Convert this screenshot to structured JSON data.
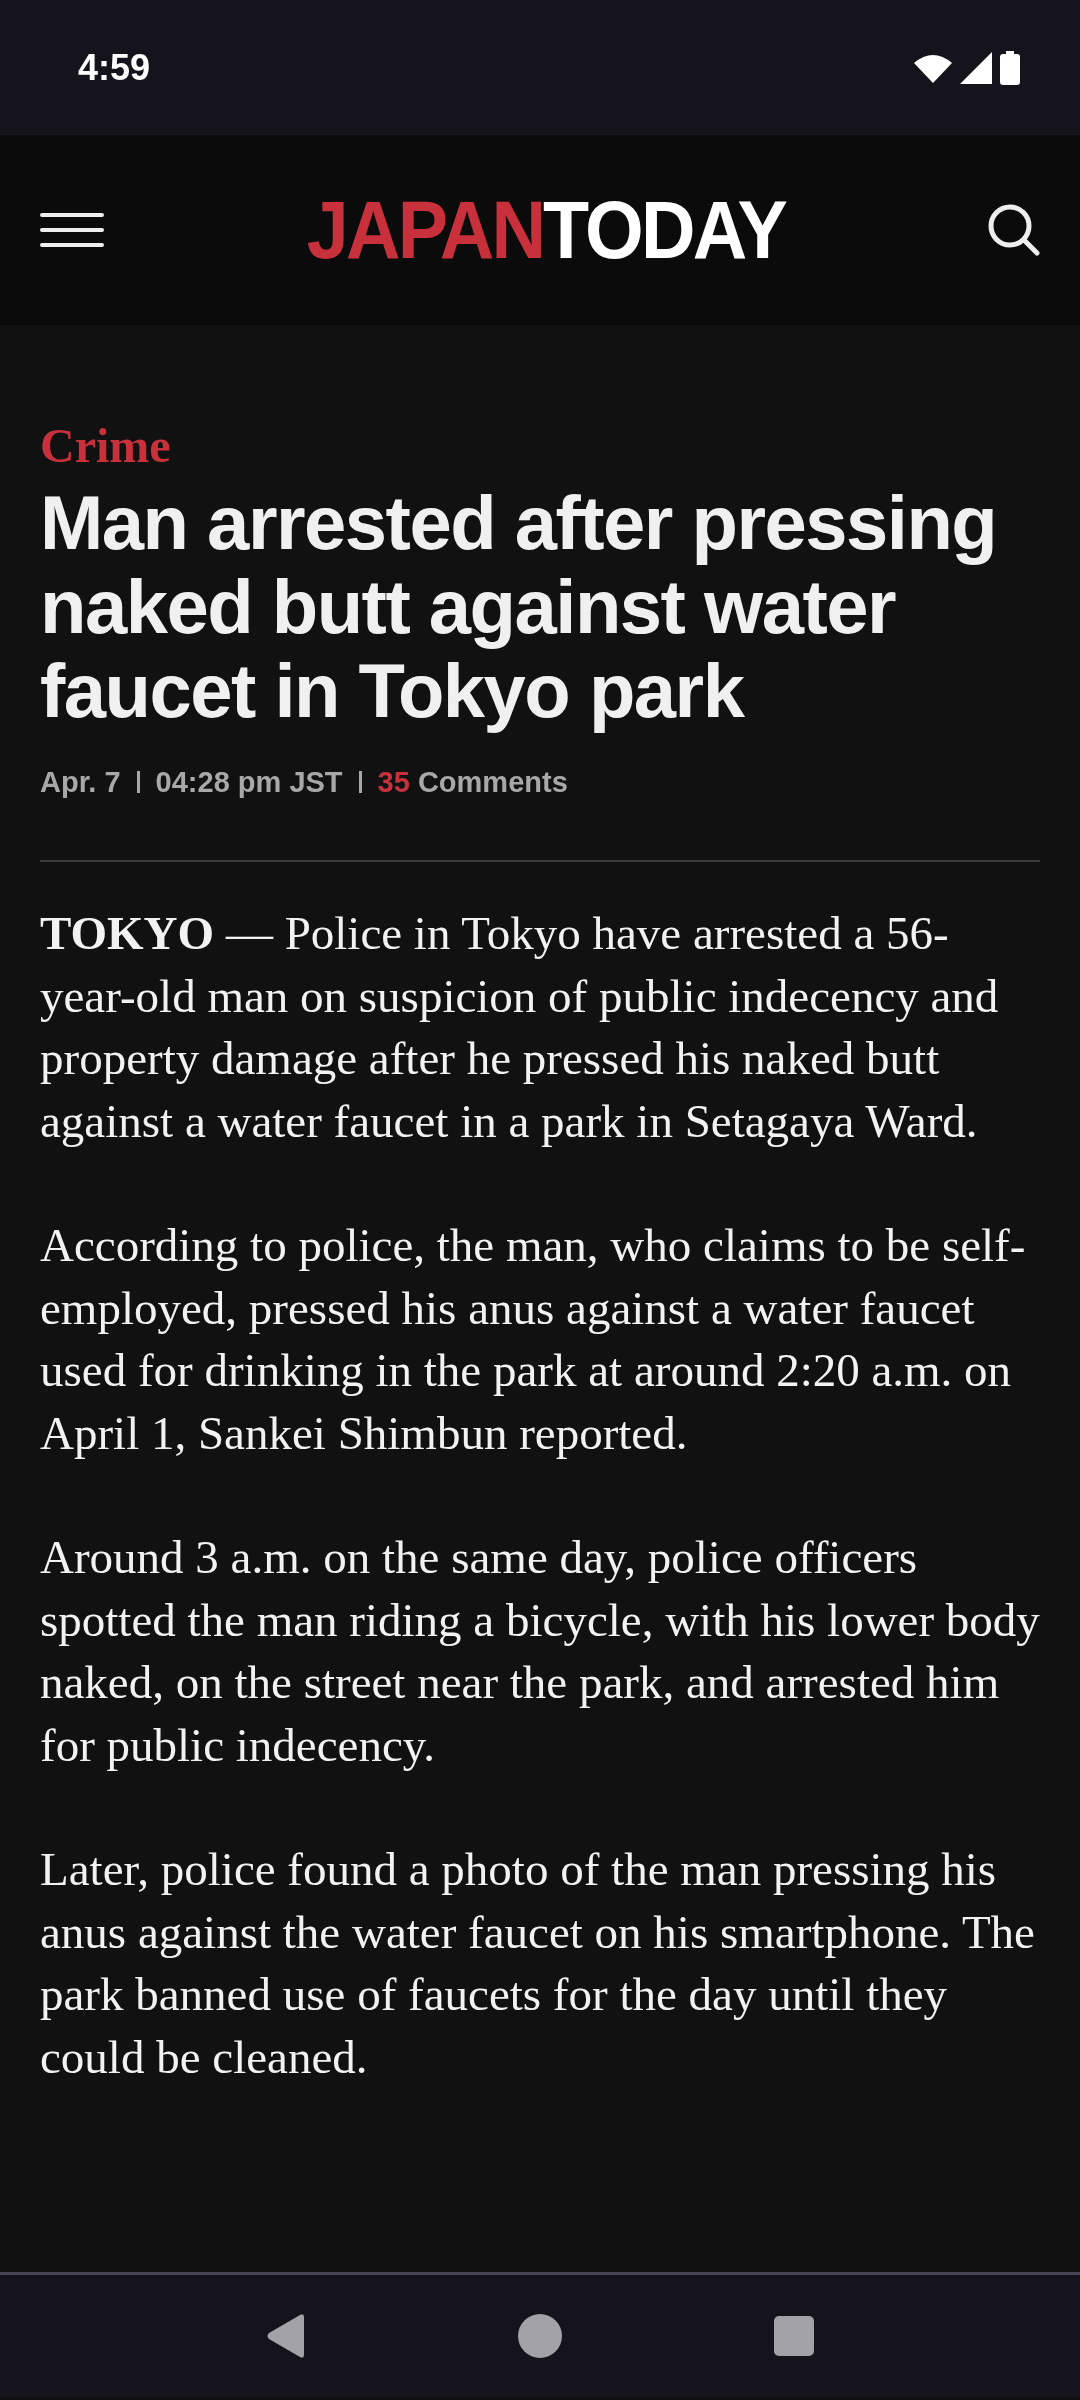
{
  "status_bar": {
    "time": "4:59"
  },
  "header": {
    "logo_parts": [
      {
        "text": "JAPAN",
        "color": "#c8313b"
      },
      {
        "text": "TODAY",
        "color": "#ffffff"
      }
    ]
  },
  "article": {
    "category": "Crime",
    "headline": "Man arrested after pressing naked butt against water faucet in Tokyo park",
    "meta": {
      "date": "Apr. 7",
      "time": "04:28 pm JST",
      "comment_count": "35",
      "comments_label": "Comments"
    },
    "paragraphs": [
      "**TOKYO** — Police in Tokyo have arrested a 56-year-old man on suspicion of public indecency and property damage after he pressed his naked butt against a water faucet in a park in Setagaya Ward.",
      "According to police, the man, who claims to be self-employed, pressed his anus against a water faucet used for drinking in the park at around 2:20 a.m. on April 1, Sankei Shimbun reported.",
      "Around 3 a.m. on the same day, police officers spotted the man riding a bicycle, with his lower body naked, on the street near the park, and arrested him for public indecency.",
      "Later, police found a photo of the man pressing his anus against the water faucet on his smartphone. The park banned use of faucets for the day until they could be cleaned."
    ]
  }
}
